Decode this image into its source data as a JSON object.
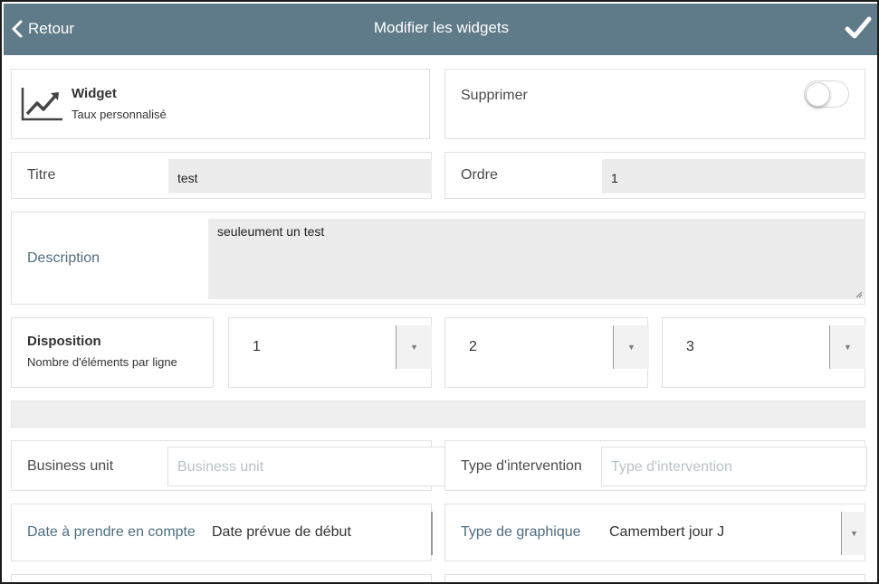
{
  "header": {
    "back_label": "Retour",
    "title": "Modifier les widgets"
  },
  "widget_card": {
    "title": "Widget",
    "subtitle": "Taux personnalisé"
  },
  "delete_card": {
    "label": "Supprimer",
    "toggle_on": false
  },
  "title_field": {
    "label": "Titre",
    "value": "test"
  },
  "order_field": {
    "label": "Ordre",
    "value": "1"
  },
  "description_field": {
    "label": "Description",
    "value": "seuleument un test"
  },
  "disposition": {
    "title": "Disposition",
    "subtitle": "Nombre d'éléments par ligne",
    "selects": [
      "1",
      "2",
      "3"
    ]
  },
  "business_unit": {
    "label": "Business unit",
    "placeholder": "Business unit"
  },
  "intervention_type": {
    "label": "Type d'intervention",
    "placeholder": "Type d'intervention"
  },
  "date_field": {
    "label": "Date à prendre en compte",
    "value": "Date prévue de début"
  },
  "chart_type": {
    "label": "Type de graphique",
    "value": "Camembert jour J"
  },
  "icons": {
    "back": "chevron-left-icon",
    "check": "check-icon",
    "widget": "trending-up-chart-icon",
    "dropdown": "dropdown-arrow-icon"
  },
  "colors": {
    "header_bg": "#5f7a88",
    "field_bg": "#ececec",
    "label_blue": "#4f6c80"
  }
}
